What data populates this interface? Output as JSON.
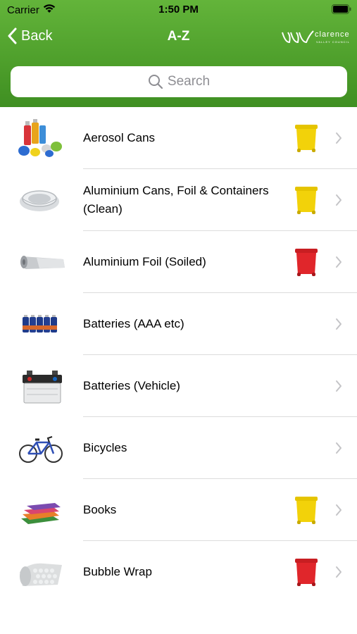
{
  "status_bar": {
    "carrier": "Carrier",
    "time": "1:50 PM"
  },
  "nav": {
    "back_label": "Back",
    "title": "A-Z",
    "logo_text": "clarence",
    "logo_subtext": "VALLEY COUNCIL"
  },
  "search": {
    "placeholder": "Search"
  },
  "colors": {
    "header_green": "#4fa02c",
    "yellow_bin": "#f2d20a",
    "red_bin": "#e0262b",
    "separator": "#dcdcdc"
  },
  "items": [
    {
      "label": "Aerosol Cans",
      "image": "aerosol-cans-icon",
      "bin": "yellow"
    },
    {
      "label": "Aluminium Cans, Foil & Containers (Clean)",
      "image": "aluminium-containers-icon",
      "bin": "yellow"
    },
    {
      "label": "Aluminium Foil (Soiled)",
      "image": "aluminium-foil-icon",
      "bin": "red"
    },
    {
      "label": "Batteries (AAA etc)",
      "image": "batteries-icon",
      "bin": "none"
    },
    {
      "label": "Batteries (Vehicle)",
      "image": "car-battery-icon",
      "bin": "none"
    },
    {
      "label": "Bicycles",
      "image": "bicycle-icon",
      "bin": "none"
    },
    {
      "label": "Books",
      "image": "books-icon",
      "bin": "yellow"
    },
    {
      "label": "Bubble Wrap",
      "image": "bubble-wrap-icon",
      "bin": "red"
    }
  ]
}
